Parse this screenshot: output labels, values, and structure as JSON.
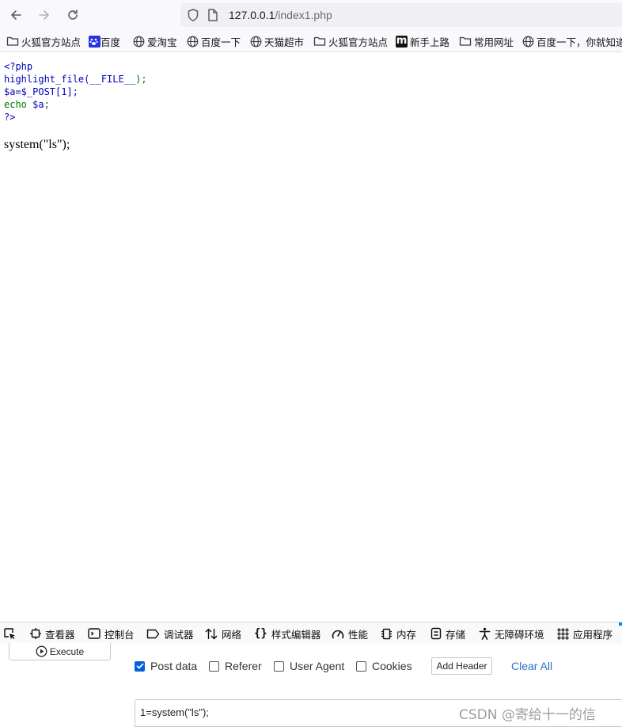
{
  "browser": {
    "url_host": "127.0.0.1",
    "url_path": "/index1.php"
  },
  "bookmarks": [
    {
      "label": "火狐官方站点",
      "icon": "folder-icon"
    },
    {
      "label": "百度",
      "icon": "baidu-paw-icon"
    },
    {
      "label": "爱淘宝",
      "icon": "globe-icon"
    },
    {
      "label": "百度一下",
      "icon": "globe-icon"
    },
    {
      "label": "天猫超市",
      "icon": "globe-icon"
    },
    {
      "label": "火狐官方站点",
      "icon": "folder-icon"
    },
    {
      "label": "新手上路",
      "icon": "m-logo-icon"
    },
    {
      "label": "常用网址",
      "icon": "folder-icon"
    },
    {
      "label": "百度一下，你就知道",
      "icon": "globe-icon"
    }
  ],
  "page": {
    "code_lines": [
      {
        "text": "<?php",
        "color": "#0000bb"
      },
      {
        "text": "highlight_file(",
        "color": "#0000bb",
        "rest": "__FILE__",
        "rest_color": "#0000bb",
        "tail": ");",
        "tail_color": "#007700"
      },
      {
        "text": "$a=$_POST[1];",
        "color": "#0000bb"
      },
      {
        "text": "echo ",
        "color": "#007700",
        "rest": "$a",
        "rest_color": "#0000bb",
        "tail": ";",
        "tail_color": "#007700"
      },
      {
        "text": "?>",
        "color": "#0000bb"
      }
    ],
    "output": "system(\"ls\");"
  },
  "devtools": {
    "tabs": [
      {
        "label": "查看器",
        "icon": "inspector-icon"
      },
      {
        "label": "控制台",
        "icon": "console-icon"
      },
      {
        "label": "调试器",
        "icon": "debugger-icon"
      },
      {
        "label": "网络",
        "icon": "network-icon"
      },
      {
        "label": "样式编辑器",
        "icon": "style-editor-icon"
      },
      {
        "label": "性能",
        "icon": "performance-icon"
      },
      {
        "label": "内存",
        "icon": "memory-icon"
      },
      {
        "label": "存储",
        "icon": "storage-icon"
      },
      {
        "label": "无障碍环境",
        "icon": "accessibility-icon"
      },
      {
        "label": "应用程序",
        "icon": "application-icon"
      }
    ],
    "accent_color": "#0a84ff"
  },
  "hackbar": {
    "execute_label": "Execute",
    "options": [
      {
        "label": "Post data",
        "checked": true
      },
      {
        "label": "Referer",
        "checked": false
      },
      {
        "label": "User Agent",
        "checked": false
      },
      {
        "label": "Cookies",
        "checked": false
      }
    ],
    "add_header_label": "Add Header",
    "clear_all_label": "Clear All",
    "post_data_value": "1=system(\"ls\");"
  },
  "watermark": "CSDN @寄给十一的信"
}
